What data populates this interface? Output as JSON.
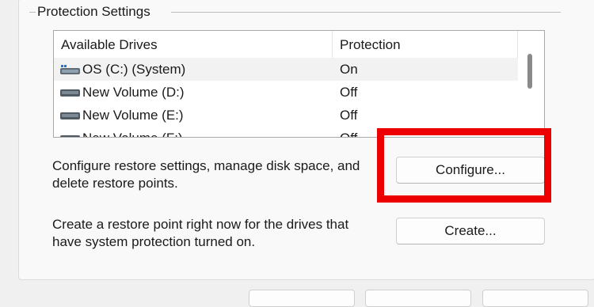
{
  "group": {
    "title": "Protection Settings"
  },
  "list": {
    "headers": {
      "drives": "Available Drives",
      "protection": "Protection"
    },
    "rows": [
      {
        "name": "OS (C:) (System)",
        "protection": "On",
        "icon": "system-drive-icon",
        "selected": true
      },
      {
        "name": "New Volume (D:)",
        "protection": "Off",
        "icon": "drive-icon"
      },
      {
        "name": "New Volume (E:)",
        "protection": "Off",
        "icon": "drive-icon"
      },
      {
        "name": "New Volume (F:)",
        "protection": "Off",
        "icon": "drive-icon"
      }
    ]
  },
  "configure": {
    "description_line1": "Configure restore settings, manage disk space, and",
    "description_line2": "delete restore points.",
    "button_label": "Configure..."
  },
  "create": {
    "description_line1": "Create a restore point right now for the drives that",
    "description_line2": "have system protection turned on.",
    "button_label": "Create..."
  },
  "colors": {
    "highlight": "#ec0000",
    "selected_row": "#f2f2f2"
  }
}
